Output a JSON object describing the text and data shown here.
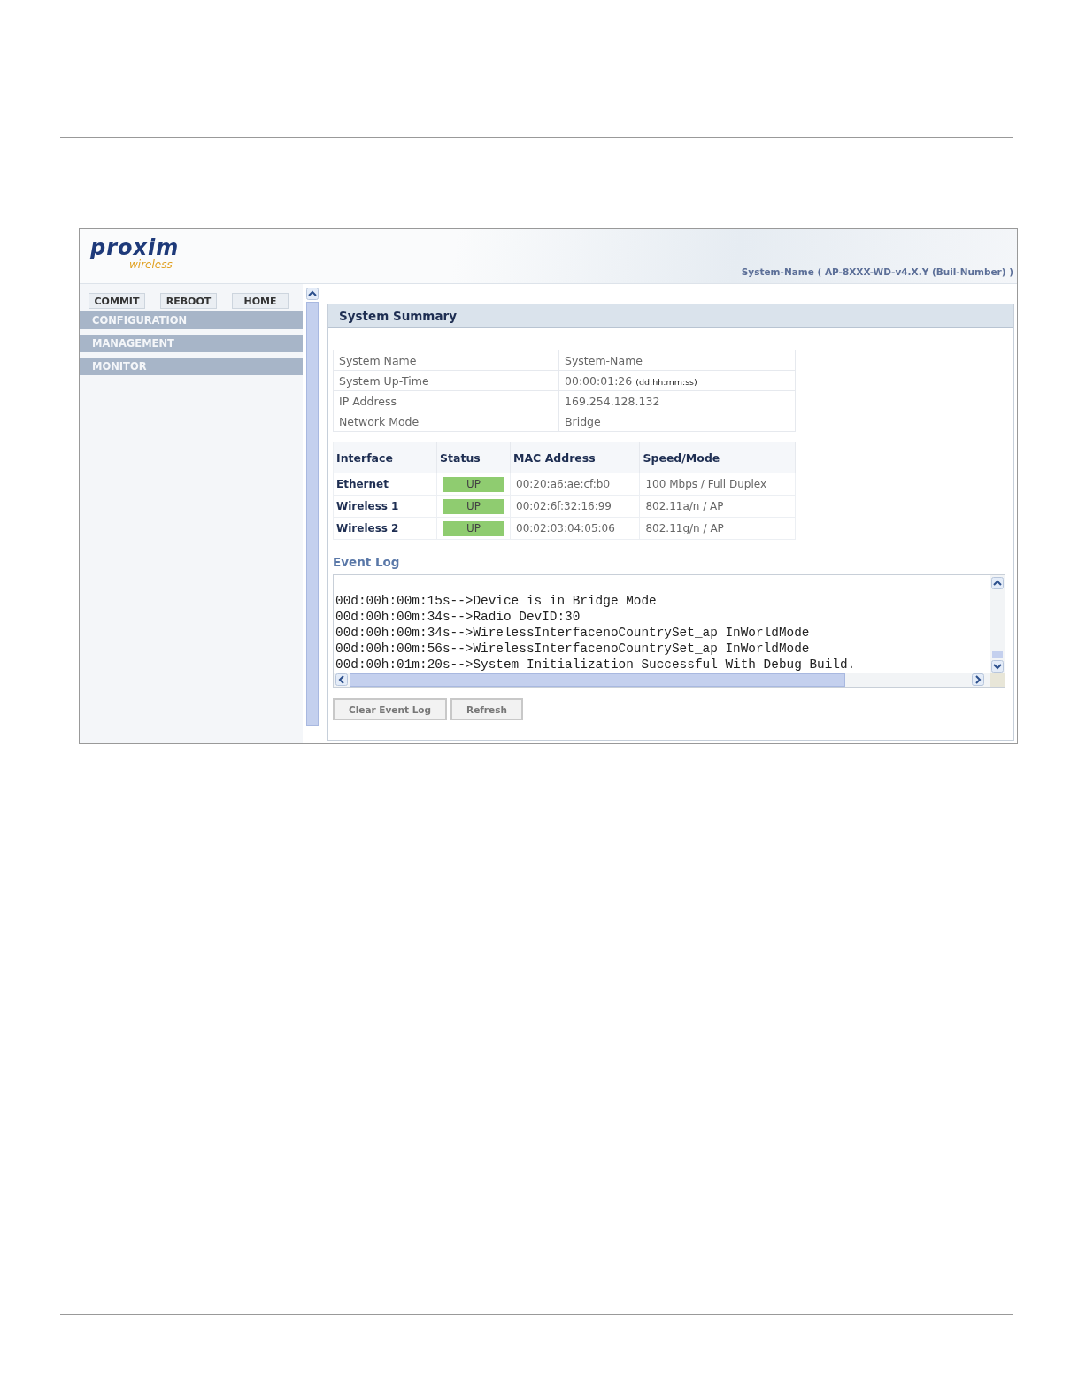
{
  "header": {
    "logo": "proxim",
    "logo_tagline": "wireless",
    "system_info": "System-Name ( AP-8XXX-WD-v4.X.Y (Buil-Number) )"
  },
  "toolbar": {
    "buttons": [
      "COMMIT",
      "REBOOT",
      "HOME"
    ]
  },
  "sidebar": {
    "items": [
      {
        "label": "CONFIGURATION",
        "selected": false
      },
      {
        "label": "MANAGEMENT",
        "selected": false
      },
      {
        "label": "MONITOR",
        "selected": false
      }
    ]
  },
  "panel": {
    "title": "System Summary",
    "summary": [
      {
        "label": "System Name",
        "value": "System-Name"
      },
      {
        "label": "System Up-Time",
        "value": "00:00:01:26",
        "unit": "(dd:hh:mm:ss)"
      },
      {
        "label": "IP Address",
        "value": "169.254.128.132"
      },
      {
        "label": "Network Mode",
        "value": "Bridge"
      }
    ],
    "interfaces": {
      "columns": [
        "Interface",
        "Status",
        "MAC Address",
        "Speed/Mode"
      ],
      "rows": [
        {
          "interface": "Ethernet",
          "status": "UP",
          "color": "#8fcc70",
          "mac": "00:20:a6:ae:cf:b0",
          "speed": "100 Mbps / Full Duplex"
        },
        {
          "interface": "Wireless 1",
          "status": "UP",
          "color": "#8fcc70",
          "mac": "00:02:6f:32:16:99",
          "speed": "802.11a/n / AP"
        },
        {
          "interface": "Wireless 2",
          "status": "UP",
          "color": "#8fcc70",
          "mac": "00:02:03:04:05:06",
          "speed": "802.11g/n / AP"
        }
      ]
    },
    "event_log": {
      "title": "Event Log",
      "lines": [
        "00d:00h:00m:15s-->Device is in Bridge Mode",
        "00d:00h:00m:34s-->Radio DevID:30",
        "00d:00h:00m:34s-->WirelessInterfacenoCountrySet_ap InWorldMode",
        "00d:00h:00m:56s-->WirelessInterfacenoCountrySet_ap InWorldMode",
        "00d:00h:01m:20s-->System Initialization Successful With Debug Build."
      ]
    },
    "buttons": [
      "Clear Event Log",
      "Refresh"
    ]
  }
}
